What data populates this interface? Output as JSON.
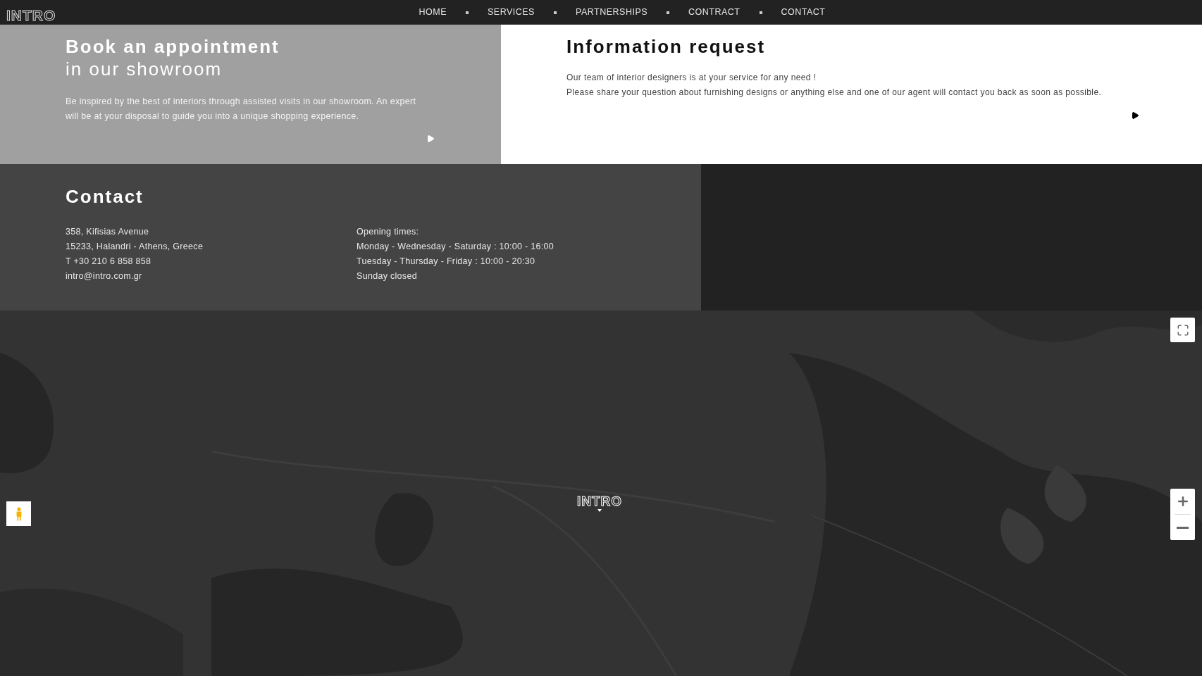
{
  "header": {
    "logo": "INTRO",
    "nav": [
      {
        "label": "HOME"
      },
      {
        "label": "SERVICES"
      },
      {
        "label": "PARTNERSHIPS"
      },
      {
        "label": "CONTRACT"
      },
      {
        "label": "CONTACT"
      }
    ]
  },
  "appointment": {
    "title": "Book an appointment",
    "subtitle": "in our showroom",
    "text": "Be inspired by the best of interiors through assisted visits in our showroom. An expert will be at your disposal to guide you into a unique shopping experience."
  },
  "information": {
    "title": "Information request",
    "lines": [
      "Our team of interior designers is at your service for any need !",
      "Please share your question about furnishing designs or anything else and one of our agent will contact you back as soon as possible."
    ]
  },
  "contact": {
    "title": "Contact",
    "address": [
      "358, Kifisias Avenue",
      "15233, Halandri - Athens, Greece",
      "T +30 210 6 858 858",
      "intro@intro.com.gr"
    ],
    "hours": [
      "Opening times:",
      "Monday - Wednesday - Saturday : 10:00 - 16:00",
      "Tuesday - Thursday - Friday : 10:00 - 20:30",
      "Sunday closed"
    ]
  },
  "map": {
    "marker": "INTRO"
  }
}
